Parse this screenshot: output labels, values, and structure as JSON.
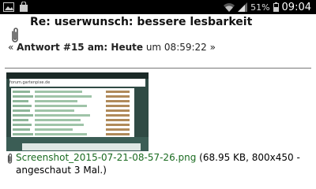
{
  "statusbar": {
    "battery": "51%",
    "time": "09:04",
    "icons": [
      "photo-icon",
      "shopping-bag-icon",
      "wifi-icon",
      "signal-icon",
      "battery-icon"
    ]
  },
  "post": {
    "title": "Re: userwunsch: bessere lesbarkeit",
    "meta_prefix": "« ",
    "meta_bold": "Antwort #15 am: Heute",
    "meta_suffix": " um 08:59:22 »",
    "icon": "paperclip-icon"
  },
  "thumbnail": {
    "url": "forum.gartenpixe.de"
  },
  "attachment": {
    "filename": "Screenshot_2015-07-21-08-57-26.png",
    "details": " (68.95 KB, 800x450 - angeschaut 3 Mal.)",
    "link_color": "#1a6b20"
  }
}
